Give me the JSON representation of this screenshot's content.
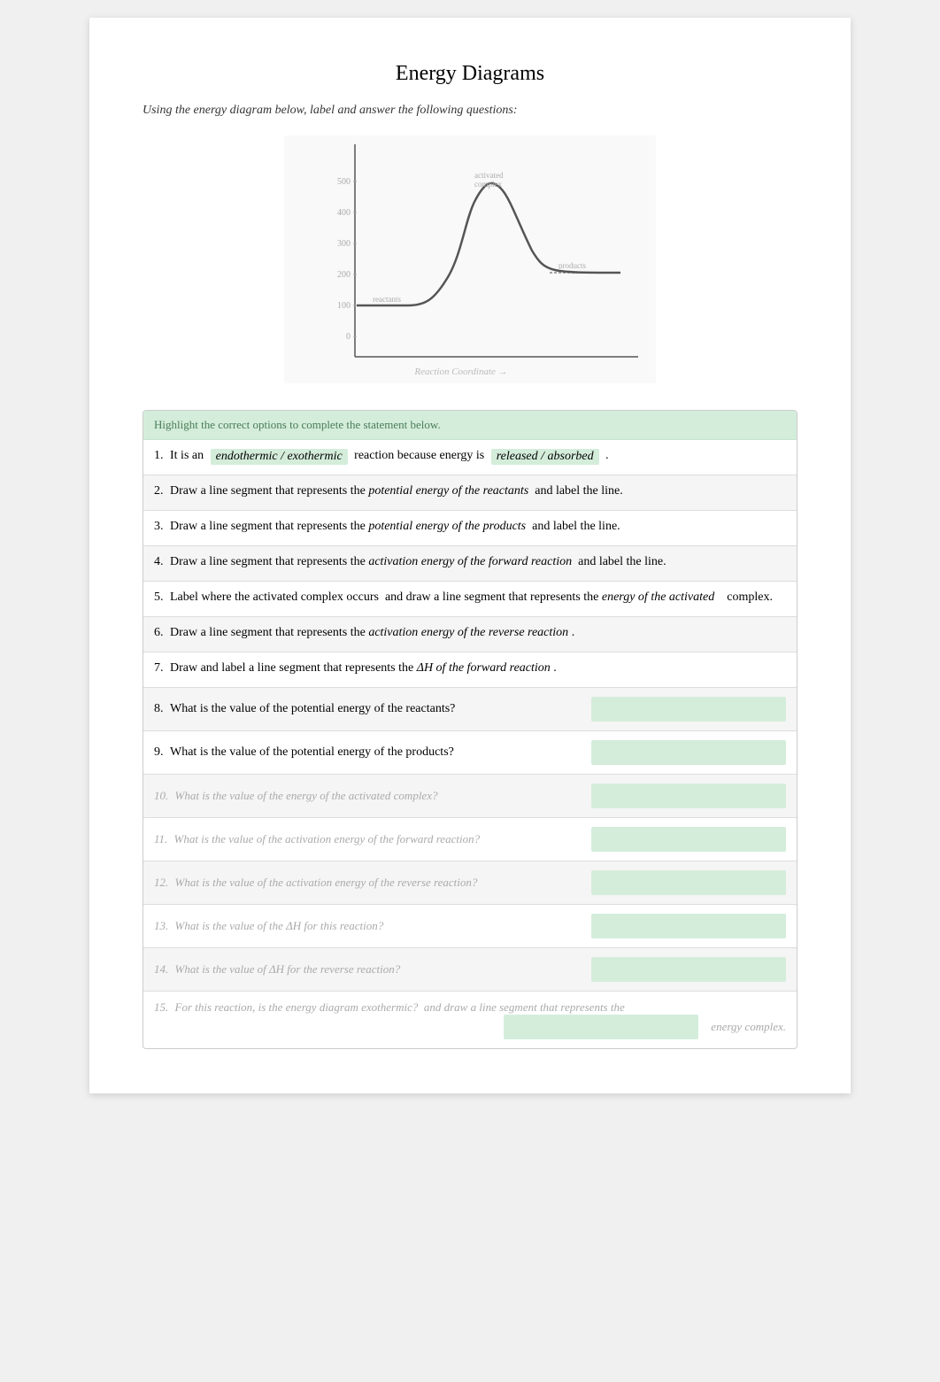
{
  "page": {
    "title": "Energy Diagrams",
    "instructions": "Using the energy diagram below, label and answer the following questions:",
    "highlight_instruction": "Highlight the correct options to complete the statement below.",
    "questions": [
      {
        "id": "q1",
        "number": "1.",
        "text_before": "It is an",
        "highlight1": "endothermic / exothermic",
        "text_middle": "reaction because energy is",
        "highlight2": "released / absorbed",
        "text_after": ".",
        "has_answer_box": false,
        "shaded": false
      },
      {
        "id": "q2",
        "number": "2.",
        "text": "Draw a line segment that represents the",
        "inline": "potential energy of the reactants",
        "text_after": "and label the line.",
        "has_answer_box": false,
        "shaded": true
      },
      {
        "id": "q3",
        "number": "3.",
        "text": "Draw a line segment that represents the",
        "inline": "potential energy of the products",
        "text_after": "and label the line.",
        "has_answer_box": false,
        "shaded": false
      },
      {
        "id": "q4",
        "number": "4.",
        "text": "Draw a line segment that represents the",
        "inline": "activation energy of the forward reaction",
        "text_after": "and label the line.",
        "has_answer_box": false,
        "shaded": true
      },
      {
        "id": "q5",
        "number": "5.",
        "text": "Label where the activated complex occurs",
        "text_middle": "and draw a line segment that represents the",
        "inline": "energy of the activated complex",
        "text_after": ".",
        "multiline": true,
        "has_answer_box": false,
        "shaded": false
      },
      {
        "id": "q6",
        "number": "6.",
        "text": "Draw a line segment that represents the",
        "inline": "activation energy of the reverse reaction",
        "text_after": ".",
        "has_answer_box": false,
        "shaded": true
      },
      {
        "id": "q7",
        "number": "7.",
        "text": "Draw and label a line segment that represents the",
        "inline": "ΔH of the forward reaction",
        "text_after": ".",
        "has_answer_box": false,
        "shaded": false
      },
      {
        "id": "q8",
        "number": "8.",
        "text": "What is the value of the potential energy of the reactants?",
        "has_answer_box": true,
        "shaded": true
      },
      {
        "id": "q9",
        "number": "9.",
        "text": "What is the value of the potential energy of the products?",
        "has_answer_box": true,
        "shaded": false
      },
      {
        "id": "q10",
        "number": "10.",
        "text_blurred": "What is the value of the energy of the activated complex?",
        "has_answer_box": true,
        "shaded": true,
        "blurred": true
      },
      {
        "id": "q11",
        "number": "11.",
        "text_blurred": "What is the value of the activation energy of the forward reaction?",
        "has_answer_box": true,
        "shaded": false,
        "blurred": true
      },
      {
        "id": "q12",
        "number": "12.",
        "text_blurred": "What is the value of the activation energy of the reverse reaction?",
        "has_answer_box": true,
        "shaded": true,
        "blurred": true
      },
      {
        "id": "q13",
        "number": "13.",
        "text_blurred": "What is the value of the ΔH for this reaction?",
        "has_answer_box": true,
        "shaded": false,
        "blurred": true
      },
      {
        "id": "q14",
        "number": "14.",
        "text_blurred": "What is the value of the ΔH for the reverse reaction?",
        "has_answer_box": true,
        "shaded": true,
        "blurred": true
      },
      {
        "id": "q15",
        "number": "15.",
        "text_blurred": "For this reaction, is the energy diagram exothermic?",
        "has_answer_box": true,
        "shaded": false,
        "blurred": true,
        "multiline": true
      }
    ]
  }
}
